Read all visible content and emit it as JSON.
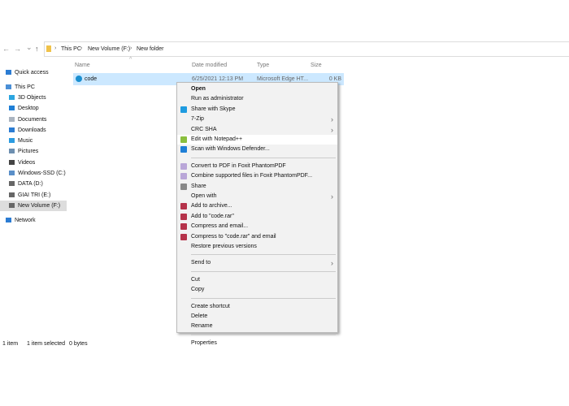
{
  "nav": {
    "back": "←",
    "forward": "→",
    "recent": "⌄",
    "up": "↑"
  },
  "breadcrumb": [
    "This PC",
    "New Volume (F:)",
    "New folder"
  ],
  "sidebar": {
    "items": [
      {
        "label": "Quick access",
        "icon": "star-icon",
        "color": "#2b7cd3"
      },
      {
        "label": "This PC",
        "icon": "computer-icon",
        "color": "#4a8fd6"
      },
      {
        "label": "3D Objects",
        "icon": "cube-icon",
        "color": "#2ba5e0"
      },
      {
        "label": "Desktop",
        "icon": "desktop-icon",
        "color": "#1f7fd6"
      },
      {
        "label": "Documents",
        "icon": "document-icon",
        "color": "#aab4c0"
      },
      {
        "label": "Downloads",
        "icon": "download-icon",
        "color": "#2b7cd3"
      },
      {
        "label": "Music",
        "icon": "music-icon",
        "color": "#2b9be0"
      },
      {
        "label": "Pictures",
        "icon": "pictures-icon",
        "color": "#6d8fb0"
      },
      {
        "label": "Videos",
        "icon": "videos-icon",
        "color": "#444"
      },
      {
        "label": "Windows-SSD (C:)",
        "icon": "drive-icon",
        "color": "#5a8fc8"
      },
      {
        "label": "DATA (D:)",
        "icon": "drive-icon",
        "color": "#666"
      },
      {
        "label": "GIAI TRI (E:)",
        "icon": "drive-icon",
        "color": "#666"
      },
      {
        "label": "New Volume (F:)",
        "icon": "drive-icon",
        "color": "#666",
        "selected": true
      },
      {
        "label": "Network",
        "icon": "network-icon",
        "color": "#2b7cd3"
      }
    ]
  },
  "columns": [
    "Name",
    "Date modified",
    "Type",
    "Size"
  ],
  "files": [
    {
      "name": "code",
      "date": "6/25/2021 12:13 PM",
      "type": "Microsoft Edge HT...",
      "size": "0 KB",
      "icon": "edge-icon"
    }
  ],
  "menu": {
    "items": [
      {
        "label": "Open",
        "bold": true
      },
      {
        "label": "Run as administrator"
      },
      {
        "label": "Share with Skype",
        "icon": "skype-icon",
        "color": "#1e9be0"
      },
      {
        "label": "7-Zip",
        "submenu": true
      },
      {
        "label": "CRC SHA",
        "submenu": true
      },
      {
        "label": "Edit with Notepad++",
        "icon": "notepadpp-icon",
        "color": "#8bbf3f",
        "highlighted": true
      },
      {
        "label": "Scan with Windows Defender...",
        "icon": "defender-icon",
        "color": "#1f7fd6"
      },
      {
        "sep": true
      },
      {
        "label": "Convert to PDF in Foxit PhantomPDF",
        "icon": "foxit-icon",
        "color": "#b9a6d8"
      },
      {
        "label": "Combine supported files in Foxit PhantomPDF...",
        "icon": "foxit-icon",
        "color": "#b9a6d8"
      },
      {
        "label": "Share",
        "icon": "share-icon",
        "color": "#888"
      },
      {
        "label": "Open with",
        "submenu": true
      },
      {
        "label": "Add to archive...",
        "icon": "winrar-icon",
        "color": "#b5324a"
      },
      {
        "label": "Add to \"code.rar\"",
        "icon": "winrar-icon",
        "color": "#b5324a"
      },
      {
        "label": "Compress and email...",
        "icon": "winrar-icon",
        "color": "#b5324a"
      },
      {
        "label": "Compress to \"code.rar\" and email",
        "icon": "winrar-icon",
        "color": "#b5324a"
      },
      {
        "label": "Restore previous versions"
      },
      {
        "sep": true
      },
      {
        "label": "Send to",
        "submenu": true
      },
      {
        "sep": true
      },
      {
        "label": "Cut"
      },
      {
        "label": "Copy"
      },
      {
        "sep": true
      },
      {
        "label": "Create shortcut"
      },
      {
        "label": "Delete"
      },
      {
        "label": "Rename"
      },
      {
        "sep": true
      },
      {
        "label": "Properties"
      }
    ]
  },
  "status": {
    "count": "1 item",
    "selected": "1 item selected",
    "size": "0 bytes"
  }
}
